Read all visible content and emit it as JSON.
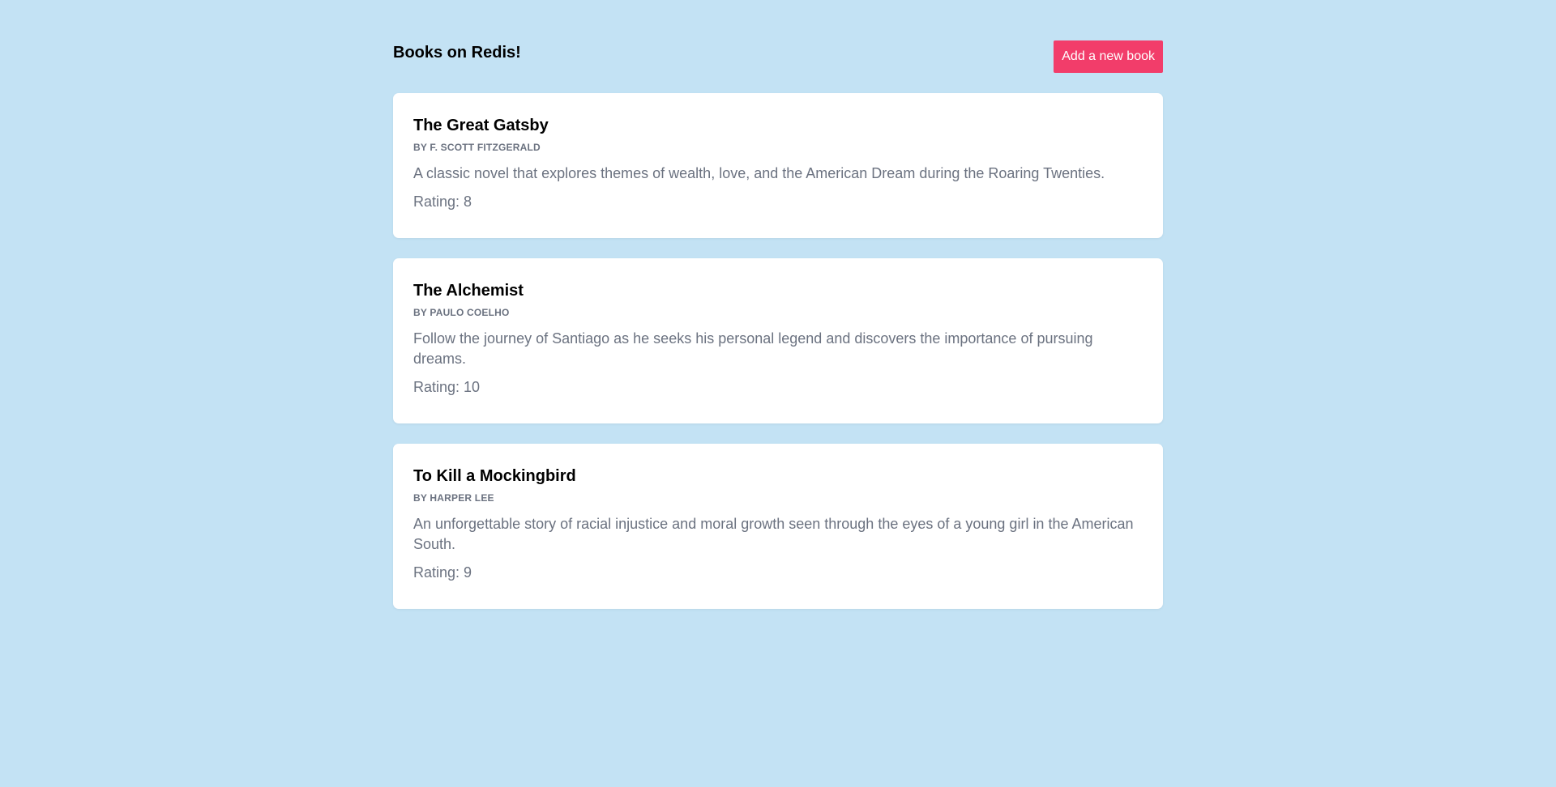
{
  "header": {
    "title": "Books on Redis!",
    "add_button_label": "Add a new book"
  },
  "books": [
    {
      "title": "The Great Gatsby",
      "author": "By F. Scott Fitzgerald",
      "description": "A classic novel that explores themes of wealth, love, and the American Dream during the Roaring Twenties.",
      "rating": "Rating: 8"
    },
    {
      "title": "The Alchemist",
      "author": "By Paulo Coelho",
      "description": "Follow the journey of Santiago as he seeks his personal legend and discovers the importance of pursuing dreams.",
      "rating": "Rating: 10"
    },
    {
      "title": "To Kill a Mockingbird",
      "author": "By Harper Lee",
      "description": "An unforgettable story of racial injustice and moral growth seen through the eyes of a young girl in the American South.",
      "rating": "Rating: 9"
    }
  ],
  "colors": {
    "background": "#c3e2f4",
    "accent": "#f23d6a",
    "card": "#ffffff",
    "muted_text": "#6b7280"
  }
}
